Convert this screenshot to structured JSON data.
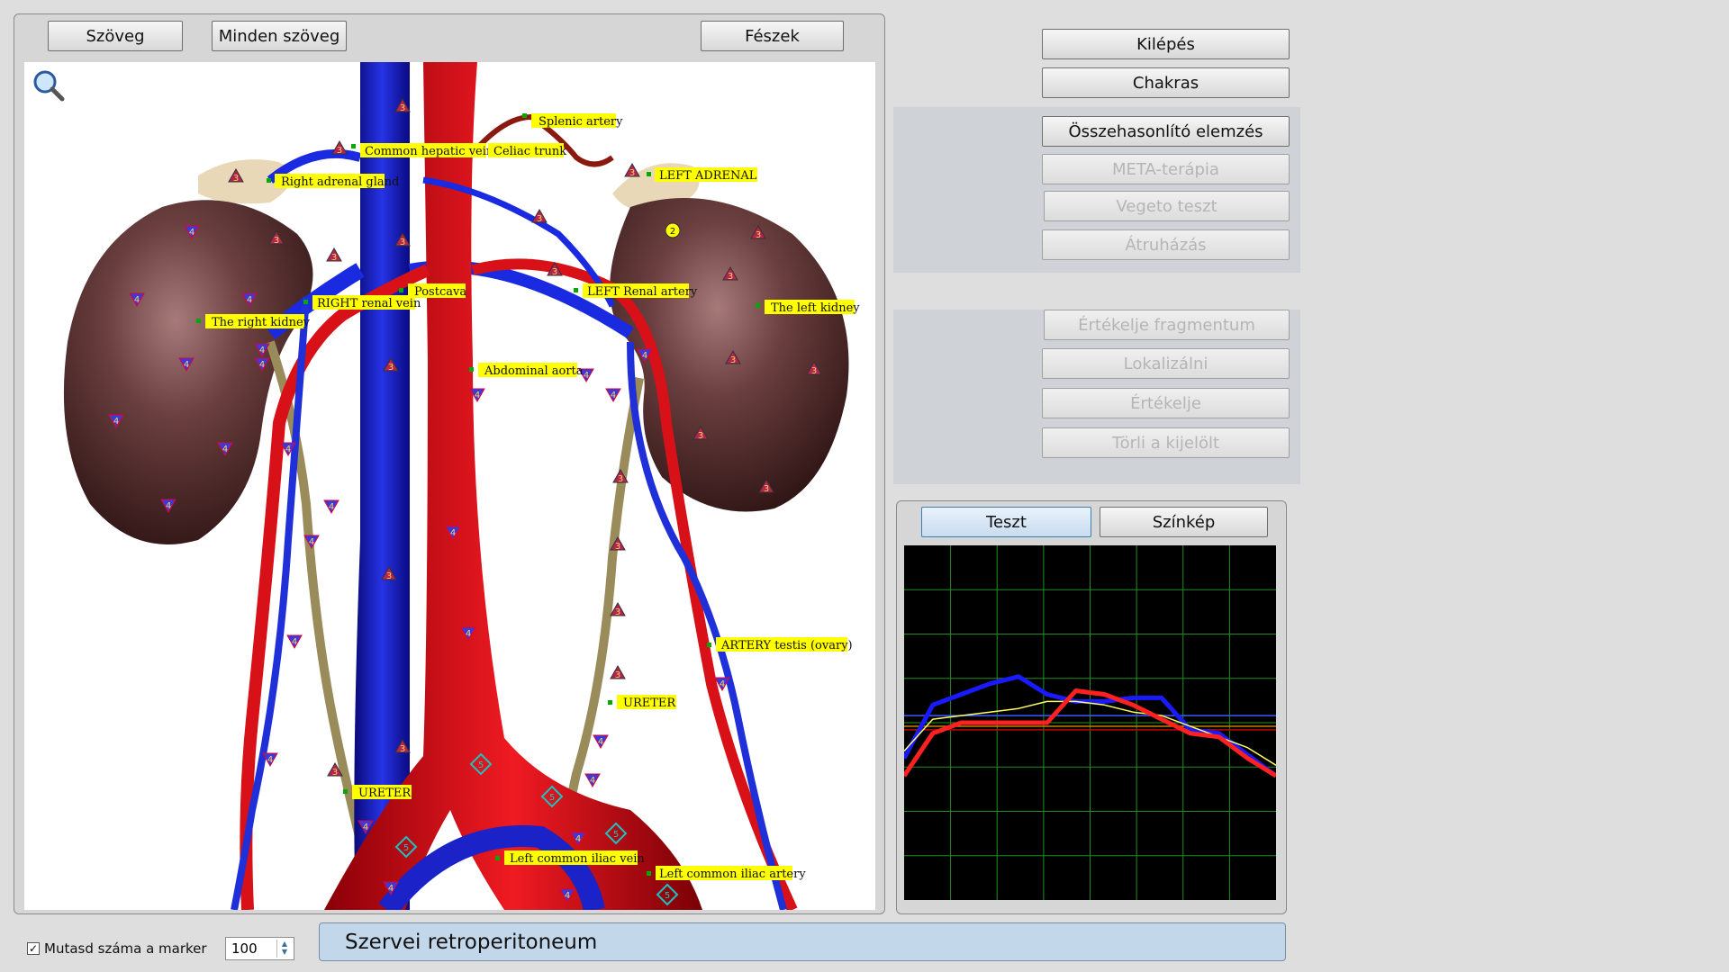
{
  "toolbar": {
    "text": "Szöveg",
    "all_text": "Minden szöveg",
    "nest": "Fészek"
  },
  "right_panel": {
    "exit": "Kilépés",
    "chakras": "Chakras",
    "compare": "Összehasonlító elemzés",
    "meta": "META-terápia",
    "vegeto": "Vegeto teszt",
    "transfer": "Átruházás",
    "eval_fragment": "Értékelje fragmentum",
    "localize": "Lokalizálni",
    "evaluate": "Értékelje",
    "clear": "Törli a kijelölt"
  },
  "graph_panel": {
    "test": "Teszt",
    "spectrum": "Színkép"
  },
  "labels": {
    "splenic": "Splenic artery",
    "hepatic": "Common hepatic vein",
    "celiac": "Celiac trunk",
    "r_adrenal": "Right adrenal gland",
    "l_adrenal": "LEFT ADRENAL",
    "postcava": "Postcava",
    "r_renal": "RIGHT renal vein",
    "l_renal": "LEFT Renal artery",
    "r_kidney": "The right kidney",
    "l_kidney": "The left kidney",
    "aorta": "Abdominal aorta",
    "artery_testis": "ARTERY testis (ovary)",
    "ureter_r": "URETER",
    "ureter_l": "URETER",
    "iliac_vein": "Left common iliac vein",
    "iliac_artery": "Left common iliac artery"
  },
  "markers": {
    "n2": "2",
    "n3": "3",
    "n4": "4",
    "n5": "5"
  },
  "bottom": {
    "checkbox_label": "Mutasd száma a marker",
    "checkbox_checked": true,
    "count_value": "100",
    "title": "Szervei retroperitoneum"
  },
  "colors": {
    "accent_blue": "#1428d8",
    "accent_red": "#ff1a1a",
    "label_bg": "#ffff00",
    "title_bar": "#c2d7ea"
  },
  "chart_data": {
    "type": "line",
    "title": "",
    "grid": true,
    "background": "#000000",
    "series": [
      {
        "color": "#1a1aff",
        "values": [
          0.4,
          0.55,
          0.58,
          0.61,
          0.63,
          0.58,
          0.56,
          0.56,
          0.57,
          0.57,
          0.48,
          0.47,
          0.41,
          0.35
        ]
      },
      {
        "color": "#ffff66",
        "values": [
          0.42,
          0.51,
          0.52,
          0.53,
          0.54,
          0.56,
          0.56,
          0.55,
          0.53,
          0.52,
          0.49,
          0.46,
          0.43,
          0.38
        ]
      },
      {
        "color": "#ff2020",
        "values": [
          0.35,
          0.47,
          0.5,
          0.5,
          0.5,
          0.5,
          0.59,
          0.58,
          0.55,
          0.51,
          0.47,
          0.46,
          0.4,
          0.35
        ]
      }
    ],
    "hlines": [
      {
        "color": "#3b5bff",
        "value": 0.52
      },
      {
        "color": "#c08000",
        "value": 0.49
      },
      {
        "color": "#c00000",
        "value": 0.48
      }
    ]
  }
}
